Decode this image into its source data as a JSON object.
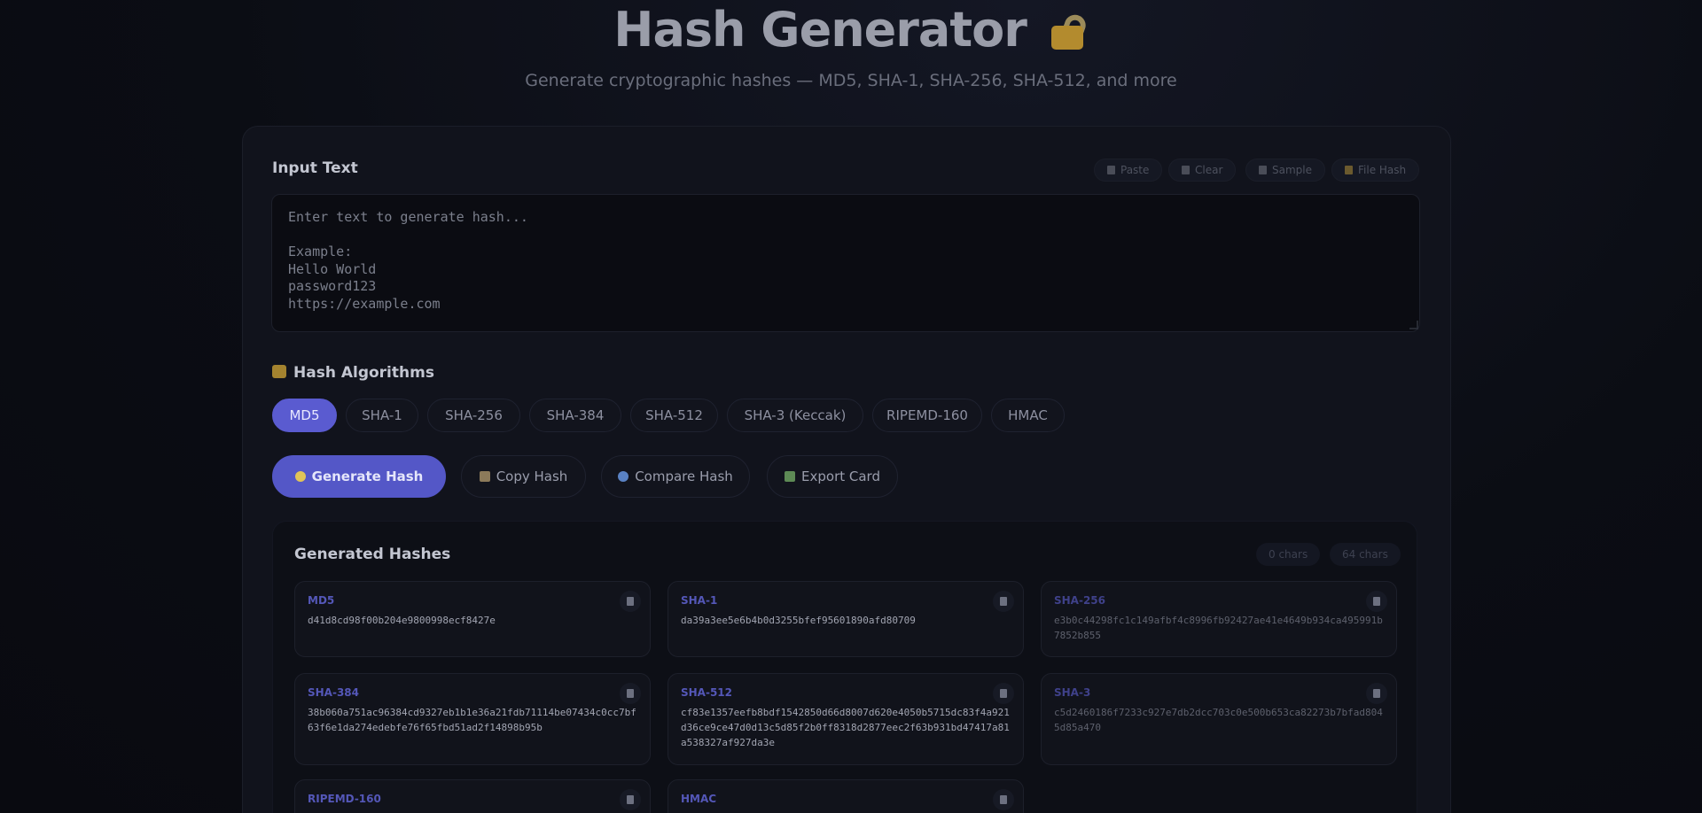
{
  "header": {
    "title": "Hash Generator",
    "subtitle": "Generate cryptographic hashes — MD5, SHA-1, SHA-256, SHA-512, and more"
  },
  "input": {
    "label": "Input Text",
    "placeholder": "Enter text to generate hash...\n\nExample:\nHello World\npassword123\nhttps://example.com",
    "tools": [
      "Paste",
      "Clear",
      "Sample",
      "File Hash"
    ]
  },
  "algorithms": {
    "label": "Hash Algorithms",
    "items": [
      "MD5",
      "SHA-1",
      "SHA-256",
      "SHA-384",
      "SHA-512",
      "SHA-3 (Keccak)",
      "RIPEMD-160",
      "HMAC"
    ],
    "selected": "MD5"
  },
  "actions": {
    "generate": "Generate Hash",
    "copy": "Copy Hash",
    "compare": "Compare Hash",
    "export": "Export Card"
  },
  "results": {
    "label": "Generated Hashes",
    "input_chars": "0 chars",
    "output_chars": "64 chars",
    "hashes": [
      {
        "name": "MD5",
        "value": "d41d8cd98f00b204e9800998ecf8427e"
      },
      {
        "name": "SHA-1",
        "value": "da39a3ee5e6b4b0d3255bfef95601890afd80709"
      },
      {
        "name": "SHA-256",
        "value": "e3b0c44298fc1c149afbf4c8996fb92427ae41e4649b934ca495991b7852b855"
      },
      {
        "name": "SHA-384",
        "value": "38b060a751ac96384cd9327eb1b1e36a21fdb71114be07434c0cc7bf63f6e1da274edebfe76f65fbd51ad2f14898b95b"
      },
      {
        "name": "SHA-512",
        "value": "cf83e1357eefb8bdf1542850d66d8007d620e4050b5715dc83f4a921d36ce9ce47d0d13c5d85f2b0ff8318d2877eec2f63b931bd47417a81a538327af927da3e"
      },
      {
        "name": "SHA-3",
        "value": "c5d2460186f7233c927e7db2dcc703c0e500b653ca82273b7bfad8045d85a470"
      },
      {
        "name": "RIPEMD-160",
        "value": ""
      },
      {
        "name": "HMAC",
        "value": ""
      }
    ]
  },
  "colors": {
    "accent": "#5a5bd0",
    "background": "#0b0d14",
    "card": "#11131c"
  },
  "icons": {
    "title": "locked-padlock-icon",
    "algorithms": "padlock-icon",
    "paste": "clipboard-icon",
    "clear": "trash-icon",
    "sample": "document-icon",
    "file_hash": "folder-icon",
    "generate": "sparkles-icon",
    "copy": "clipboard-icon",
    "compare": "magnifier-icon",
    "export": "picture-icon"
  }
}
